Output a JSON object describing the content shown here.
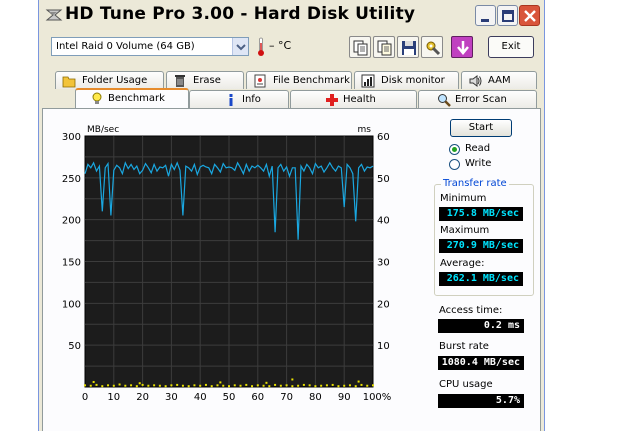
{
  "window": {
    "title": "HD Tune Pro 3.00 - Hard Disk Utility"
  },
  "toolbar": {
    "drive": "Intel  Raid 0 Volume (64 GB)",
    "temperature": "– °C",
    "exit_label": "Exit"
  },
  "tabs_top": [
    {
      "label": "Folder Usage",
      "icon": "folder-icon"
    },
    {
      "label": "Erase",
      "icon": "trash-icon"
    },
    {
      "label": "File Benchmark",
      "icon": "file-benchmark-icon"
    },
    {
      "label": "Disk monitor",
      "icon": "disk-monitor-icon"
    },
    {
      "label": "AAM",
      "icon": "speaker-icon"
    }
  ],
  "tabs_bottom": [
    {
      "label": "Benchmark",
      "icon": "bulb-icon",
      "active": true
    },
    {
      "label": "Info",
      "icon": "info-icon"
    },
    {
      "label": "Health",
      "icon": "health-cross-icon"
    },
    {
      "label": "Error Scan",
      "icon": "magnifier-icon"
    }
  ],
  "controls": {
    "start_label": "Start",
    "read_label": "Read",
    "write_label": "Write",
    "mode": "read"
  },
  "transfer_rate": {
    "title": "Transfer rate",
    "minimum_label": "Minimum",
    "minimum_value": "175.8 MB/sec",
    "maximum_label": "Maximum",
    "maximum_value": "270.9 MB/sec",
    "average_label": "Average:",
    "average_value": "262.1 MB/sec"
  },
  "stats": {
    "access_label": "Access time:",
    "access_value": "0.2 ms",
    "burst_label": "Burst rate",
    "burst_value": "1080.4 MB/sec",
    "cpu_label": "CPU usage",
    "cpu_value": "5.7%"
  },
  "colors": {
    "chart_bg": "#1c1c1c",
    "grid": "#3c3c3c",
    "transfer_line": "#1aa7e0",
    "access_points": "#e8e000",
    "value_cyan": "#00e5ff"
  },
  "chart_data": {
    "type": "line",
    "left_axis_unit": "MB/sec",
    "right_axis_unit": "ms",
    "ylim": [
      0,
      300
    ],
    "y2lim": [
      0,
      60
    ],
    "xlim": [
      0,
      100
    ],
    "yticks": [
      "300",
      "250",
      "200",
      "150",
      "100",
      "50"
    ],
    "y2ticks": [
      "60",
      "50",
      "40",
      "30",
      "20",
      "10"
    ],
    "xticks": [
      "0",
      "10",
      "20",
      "30",
      "40",
      "50",
      "60",
      "70",
      "80",
      "90",
      "100%"
    ],
    "grid": true,
    "series": [
      {
        "type": "line",
        "axis": "left",
        "x": [
          0,
          1,
          2,
          3,
          4,
          5,
          6,
          7,
          8,
          9,
          10,
          11,
          12,
          13,
          14,
          15,
          16,
          17,
          18,
          19,
          20,
          21,
          22,
          23,
          24,
          25,
          26,
          27,
          28,
          29,
          30,
          31,
          32,
          33,
          34,
          35,
          36,
          37,
          38,
          39,
          40,
          41,
          42,
          43,
          44,
          45,
          46,
          47,
          48,
          49,
          50,
          51,
          52,
          53,
          54,
          55,
          56,
          57,
          58,
          59,
          60,
          61,
          62,
          63,
          64,
          65,
          66,
          67,
          68,
          69,
          70,
          71,
          72,
          73,
          74,
          75,
          76,
          77,
          78,
          79,
          80,
          81,
          82,
          83,
          84,
          85,
          86,
          87,
          88,
          89,
          90,
          91,
          92,
          93,
          94,
          95,
          96,
          97,
          98,
          99,
          100
        ],
        "values": [
          255,
          266,
          262,
          268,
          258,
          264,
          210,
          262,
          267,
          205,
          259,
          265,
          262,
          255,
          268,
          261,
          266,
          260,
          264,
          255,
          259,
          267,
          262,
          256,
          266,
          258,
          263,
          262,
          265,
          252,
          266,
          260,
          268,
          259,
          205,
          264,
          262,
          258,
          266,
          254,
          263,
          265,
          263,
          262,
          255,
          266,
          262,
          257,
          267,
          262,
          263,
          262,
          259,
          268,
          262,
          255,
          266,
          258,
          264,
          262,
          265,
          262,
          258,
          266,
          252,
          264,
          185,
          262,
          266,
          258,
          263,
          252,
          262,
          262,
          176,
          264,
          258,
          266,
          262,
          255,
          267,
          262,
          264,
          257,
          262,
          268,
          262,
          258,
          264,
          262,
          215,
          266,
          262,
          255,
          198,
          262,
          266,
          258,
          263,
          262,
          264
        ]
      },
      {
        "type": "scatter",
        "axis": "right",
        "x": [
          0,
          2,
          4,
          6,
          8,
          10,
          12,
          14,
          16,
          18,
          20,
          22,
          24,
          26,
          28,
          30,
          32,
          34,
          36,
          38,
          40,
          42,
          44,
          46,
          48,
          50,
          52,
          54,
          56,
          58,
          60,
          62,
          64,
          66,
          68,
          70,
          72,
          74,
          76,
          78,
          80,
          82,
          84,
          86,
          88,
          90,
          92,
          94,
          96,
          98,
          100,
          3,
          19,
          47,
          63,
          72,
          95
        ],
        "values": [
          0.4,
          0.3,
          0.5,
          0.2,
          0.4,
          0.3,
          0.6,
          0.3,
          0.4,
          0.2,
          0.5,
          0.3,
          0.4,
          0.3,
          0.2,
          0.4,
          0.5,
          0.3,
          0.2,
          0.4,
          0.3,
          0.5,
          0.2,
          0.4,
          0.3,
          0.2,
          0.4,
          0.3,
          0.5,
          0.2,
          0.4,
          0.3,
          0.2,
          0.5,
          0.3,
          0.4,
          0.2,
          0.3,
          0.5,
          0.4,
          0.2,
          0.3,
          0.4,
          0.5,
          0.2,
          0.3,
          0.4,
          0.2,
          0.5,
          0.3,
          0.4,
          1.2,
          0.9,
          1.1,
          1.0,
          1.8,
          1.3
        ]
      }
    ]
  }
}
